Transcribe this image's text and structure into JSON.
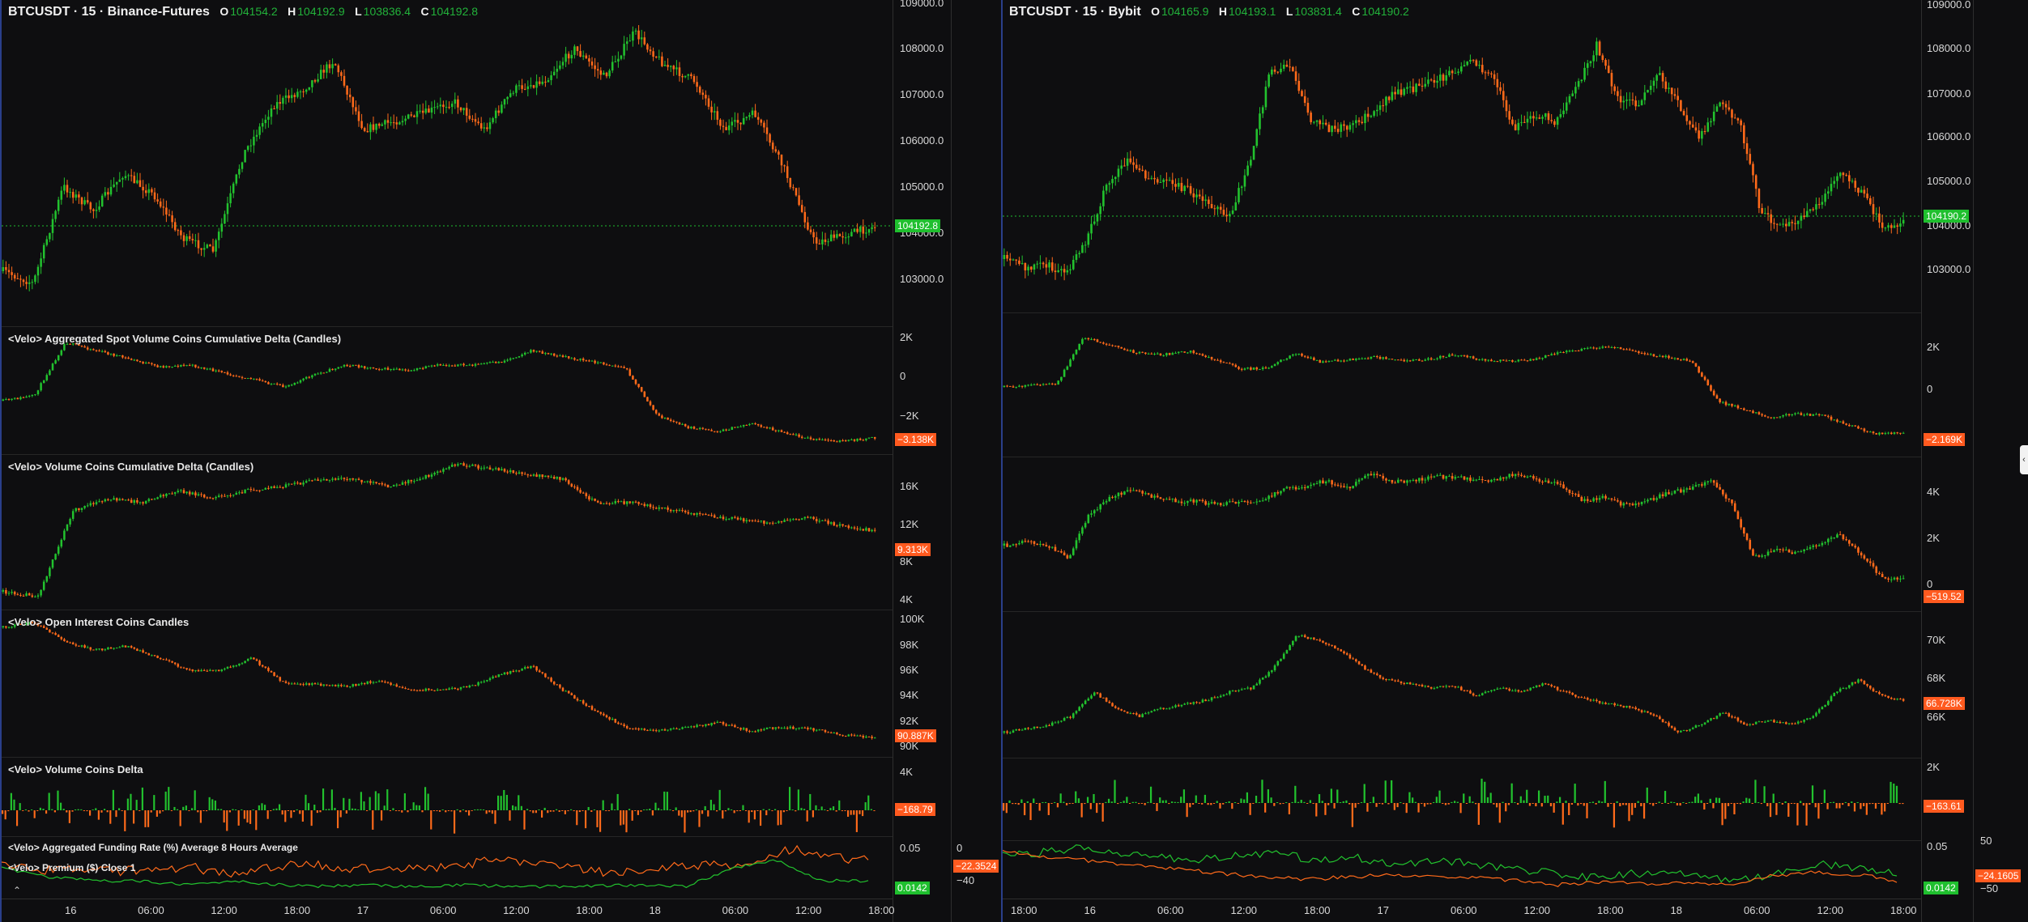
{
  "colors": {
    "up": "#22c22e",
    "down": "#ff6a1a",
    "background": "#0e0e10",
    "grid_line": "#262626",
    "price_line": "#1fbf2e"
  },
  "left": {
    "header": {
      "symbol": "BTCUSDT · 15 · Binance-Futures",
      "o_label": "O",
      "o": "104154.2",
      "h_label": "H",
      "h": "104192.9",
      "l_label": "L",
      "l": "103836.4",
      "c_label": "C",
      "c": "104192.8"
    },
    "price_axis": [
      "109000.0",
      "108000.0",
      "107000.0",
      "106000.0",
      "105000.0",
      "104000.0",
      "103000.0"
    ],
    "price_tag": "104192.8",
    "panes": [
      {
        "title": "<Velo> Aggregated Spot Volume Coins Cumulative Delta (Candles)",
        "ticks": [
          "2K",
          "0",
          "−2K"
        ],
        "tag": "−3.138K"
      },
      {
        "title": "<Velo> Volume Coins Cumulative Delta (Candles)",
        "ticks": [
          "16K",
          "12K",
          "8K",
          "4K"
        ],
        "tag": "9.313K"
      },
      {
        "title": "<Velo> Open Interest Coins Candles",
        "ticks": [
          "100K",
          "98K",
          "96K",
          "94K",
          "92K",
          "90K"
        ],
        "tag": "90.887K"
      },
      {
        "title": "<Velo> Volume Coins Delta",
        "ticks": [
          "4K"
        ],
        "tag": "−168.79"
      },
      {
        "title": "<Velo> Aggregated Funding Rate (%) Average 8 Hours Average",
        "title2": "<Velo> Premium ($) Close 1",
        "ticks": [
          "0.05"
        ],
        "tag": "0.0142",
        "ticks2": [
          "0",
          "−40"
        ],
        "tag2": "−22.3524"
      }
    ],
    "time_axis": [
      "16",
      "06:00",
      "12:00",
      "18:00",
      "17",
      "06:00",
      "12:00",
      "18:00",
      "18",
      "06:00",
      "12:00",
      "18:00"
    ]
  },
  "right": {
    "header": {
      "symbol": "BTCUSDT · 15 · Bybit",
      "o_label": "O",
      "o": "104165.9",
      "h_label": "H",
      "h": "104193.1",
      "l_label": "L",
      "l": "103831.4",
      "c_label": "C",
      "c": "104190.2"
    },
    "price_axis": [
      "109000.0",
      "108000.0",
      "107000.0",
      "106000.0",
      "105000.0",
      "104000.0",
      "103000.0"
    ],
    "price_tag": "104190.2",
    "panes": [
      {
        "ticks": [
          "2K",
          "0"
        ],
        "tag": "−2.169K"
      },
      {
        "ticks": [
          "4K",
          "2K",
          "0"
        ],
        "tag": "−519.52"
      },
      {
        "ticks": [
          "70K",
          "68K",
          "66K"
        ],
        "tag": "66.728K"
      },
      {
        "ticks": [
          "2K"
        ],
        "tag": "−163.61"
      },
      {
        "ticks": [
          "0.05"
        ],
        "tag": "0.0142",
        "ticks2": [
          "50",
          "−50"
        ],
        "tag2": "−24.1605"
      }
    ],
    "time_axis": [
      "18:00",
      "16",
      "06:00",
      "12:00",
      "18:00",
      "17",
      "06:00",
      "12:00",
      "18:00",
      "18",
      "06:00",
      "12:00",
      "18:00"
    ]
  }
}
